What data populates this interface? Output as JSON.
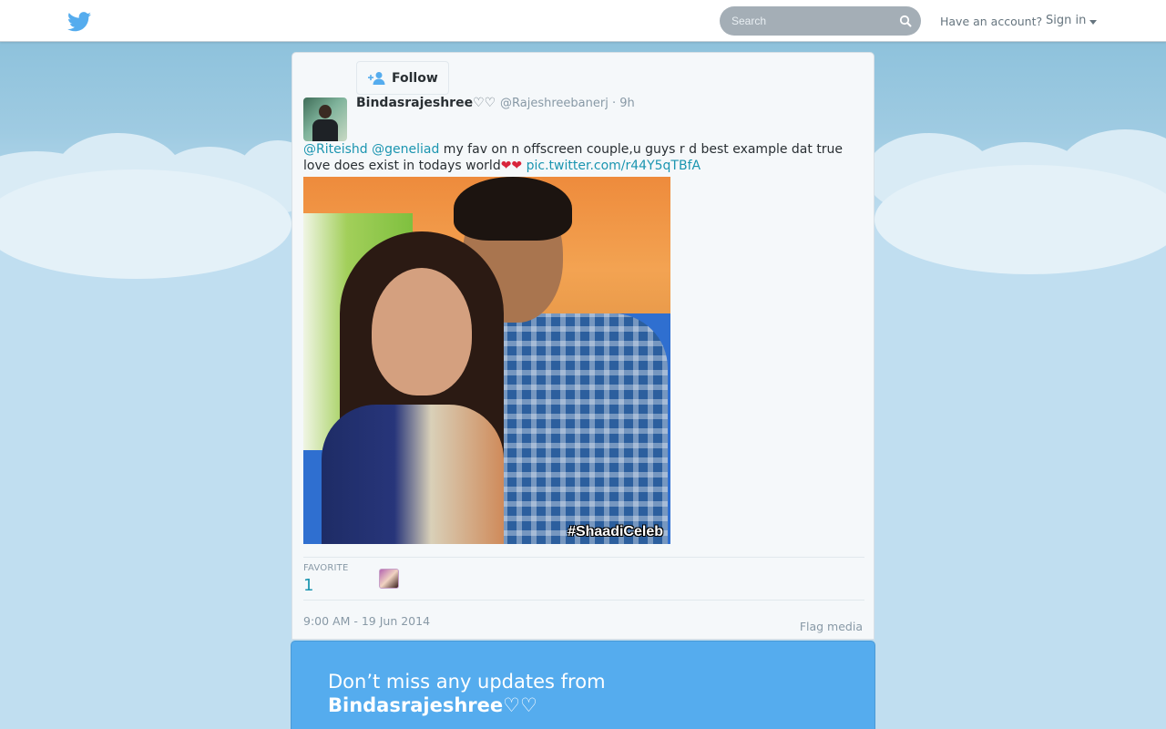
{
  "header": {
    "search_placeholder": "Search",
    "have_account": "Have an account?",
    "sign_in": "Sign in"
  },
  "tweet": {
    "follow_label": "Follow",
    "author_name": "Bindasrajeshree",
    "author_name_suffix": "♡♡",
    "handle": "@Rajeshreebanerj",
    "time_ago": "· 9h",
    "mention1": "@Riteishd",
    "mention2": "@geneliad",
    "body_text": " my fav on n offscreen couple,u guys r d best example dat true love does exist in todays world",
    "hearts": "❤❤",
    "pic_link": "pic.twitter.com/r44Y5qTBfA",
    "photo_tag": "#ShaadiCeleb",
    "favorite_label": "FAVORITE",
    "favorite_count": "1",
    "timestamp": "9:00 AM - 19 Jun 2014",
    "flag_media": "Flag media"
  },
  "banner": {
    "line1": "Don’t miss any updates from",
    "name": "Bindasrajeshree",
    "name_suffix": "♡♡"
  },
  "colors": {
    "brand_blue": "#55acee",
    "link": "#1b95b0",
    "sky": "#c0def0"
  }
}
